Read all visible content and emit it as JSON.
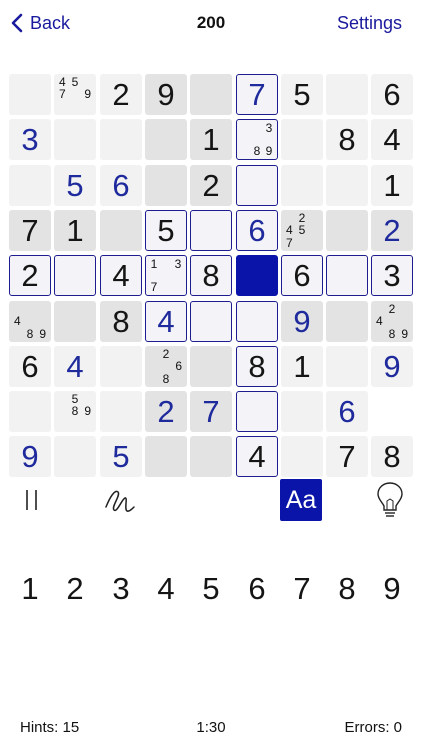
{
  "header": {
    "back_label": "Back",
    "title": "200",
    "settings_label": "Settings"
  },
  "grid": [
    [
      {
        "k": "light"
      },
      {
        "k": "light",
        "notes": [
          "4",
          "5",
          "",
          "7",
          "",
          "9",
          "",
          "",
          ""
        ]
      },
      {
        "k": "light",
        "v": "2",
        "t": "g"
      },
      {
        "k": "mid",
        "v": "9",
        "t": "g"
      },
      {
        "k": "mid"
      },
      {
        "k": "outline",
        "v": "7",
        "t": "e"
      },
      {
        "k": "light",
        "v": "5",
        "t": "g"
      },
      {
        "k": "light"
      },
      {
        "k": "light",
        "v": "6",
        "t": "g"
      }
    ],
    [
      {
        "k": "light",
        "v": "3",
        "t": "e"
      },
      {
        "k": "light"
      },
      {
        "k": "light"
      },
      {
        "k": "mid"
      },
      {
        "k": "mid",
        "v": "1",
        "t": "g"
      },
      {
        "k": "outline",
        "notes": [
          "",
          "",
          "3",
          "",
          "",
          "",
          "",
          "8",
          "9"
        ]
      },
      {
        "k": "light"
      },
      {
        "k": "light",
        "v": "8",
        "t": "g"
      },
      {
        "k": "light",
        "v": "4",
        "t": "g"
      }
    ],
    [
      {
        "k": "light"
      },
      {
        "k": "light",
        "v": "5",
        "t": "e"
      },
      {
        "k": "light",
        "v": "6",
        "t": "e"
      },
      {
        "k": "mid"
      },
      {
        "k": "mid",
        "v": "2",
        "t": "g"
      },
      {
        "k": "outline"
      },
      {
        "k": "light"
      },
      {
        "k": "light"
      },
      {
        "k": "light",
        "v": "1",
        "t": "g"
      }
    ],
    [
      {
        "k": "mid",
        "v": "7",
        "t": "g"
      },
      {
        "k": "mid",
        "v": "1",
        "t": "g"
      },
      {
        "k": "mid"
      },
      {
        "k": "outline",
        "v": "5",
        "t": "g"
      },
      {
        "k": "outline"
      },
      {
        "k": "outline",
        "v": "6",
        "t": "e"
      },
      {
        "k": "mid",
        "notes": [
          "",
          "2",
          "",
          "4",
          "5",
          "",
          "7",
          "",
          ""
        ]
      },
      {
        "k": "mid"
      },
      {
        "k": "mid",
        "v": "2",
        "t": "e"
      }
    ],
    [
      {
        "k": "outline",
        "v": "2",
        "t": "g"
      },
      {
        "k": "outline"
      },
      {
        "k": "outline",
        "v": "4",
        "t": "g"
      },
      {
        "k": "outline",
        "notes": [
          "1",
          "",
          "3",
          "",
          "",
          "",
          "7",
          "",
          ""
        ]
      },
      {
        "k": "outline",
        "v": "8",
        "t": "g"
      },
      {
        "k": "sel"
      },
      {
        "k": "outline",
        "v": "6",
        "t": "g"
      },
      {
        "k": "outline"
      },
      {
        "k": "outline",
        "v": "3",
        "t": "g"
      }
    ],
    [
      {
        "k": "mid",
        "notes": [
          "",
          "",
          "",
          "4",
          "",
          "",
          "",
          "8",
          "9"
        ]
      },
      {
        "k": "mid"
      },
      {
        "k": "mid",
        "v": "8",
        "t": "g"
      },
      {
        "k": "outline",
        "v": "4",
        "t": "e"
      },
      {
        "k": "outline"
      },
      {
        "k": "outline"
      },
      {
        "k": "mid",
        "v": "9",
        "t": "e"
      },
      {
        "k": "mid"
      },
      {
        "k": "mid",
        "notes": [
          "",
          "2",
          "",
          "4",
          "",
          "",
          "",
          "8",
          "9"
        ]
      }
    ],
    [
      {
        "k": "light",
        "v": "6",
        "t": "g"
      },
      {
        "k": "light",
        "v": "4",
        "t": "e"
      },
      {
        "k": "light"
      },
      {
        "k": "mid",
        "notes": [
          "",
          "2",
          "",
          "",
          "",
          "6",
          "",
          "8",
          ""
        ]
      },
      {
        "k": "mid"
      },
      {
        "k": "outline",
        "v": "8",
        "t": "g"
      },
      {
        "k": "light",
        "v": "1",
        "t": "g"
      },
      {
        "k": "light"
      },
      {
        "k": "light",
        "v": "9",
        "t": "e"
      }
    ],
    [
      {
        "k": "light"
      },
      {
        "k": "light",
        "notes": [
          "",
          "5",
          "",
          "",
          "8",
          "9",
          "",
          "",
          ""
        ]
      },
      {
        "k": "light"
      },
      {
        "k": "mid",
        "v": "2",
        "t": "e"
      },
      {
        "k": "mid",
        "v": "7",
        "t": "e"
      },
      {
        "k": "outline"
      },
      {
        "k": "light"
      },
      {
        "k": "light",
        "v": "6",
        "t": "e"
      },
      {
        "k": "white"
      }
    ],
    [
      {
        "k": "light",
        "v": "9",
        "t": "e"
      },
      {
        "k": "light"
      },
      {
        "k": "light",
        "v": "5",
        "t": "e"
      },
      {
        "k": "mid"
      },
      {
        "k": "mid"
      },
      {
        "k": "outline",
        "v": "4",
        "t": "g"
      },
      {
        "k": "light"
      },
      {
        "k": "light",
        "v": "7",
        "t": "g"
      },
      {
        "k": "light",
        "v": "8",
        "t": "g"
      }
    ]
  ],
  "tools": {
    "note_mode_label": "Aa"
  },
  "numpad": [
    "1",
    "2",
    "3",
    "4",
    "5",
    "6",
    "7",
    "8",
    "9"
  ],
  "footer": {
    "hints_text": "Hints: 15",
    "timer_text": "1:30",
    "errors_text": "Errors: 0"
  },
  "colors": {
    "accent": "#0b14a8",
    "entered_digit": "#1f2a9c",
    "outline": "#1d1d8f"
  },
  "icons": {
    "back": "chevron-left-icon",
    "pause": "pause-icon",
    "pencil": "pencil-scribble-icon",
    "note_mode": "aa-icon",
    "hint": "lightbulb-icon"
  }
}
